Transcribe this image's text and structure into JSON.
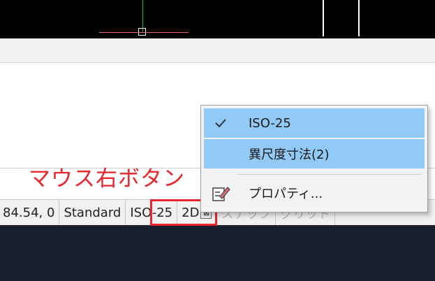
{
  "annotation": {
    "label": "マウス右ボタン"
  },
  "statusbar": {
    "coordinates": "84.54, 0",
    "text_style": "Standard",
    "dim_style": "ISO-25",
    "mode": "2D",
    "snap_label": "スナップ",
    "grid_label": "グリッド"
  },
  "context_menu": {
    "items": [
      {
        "label": "ISO-25",
        "checked": true,
        "icon": "checkmark-icon"
      },
      {
        "label": "異尺度寸法(2)",
        "highlighted": true
      },
      {
        "label": "プロパティ...",
        "icon": "properties-pencil-icon"
      }
    ]
  },
  "colors": {
    "annotation_red": "#e8262c",
    "menu_highlight": "#91c9f7",
    "viewport_bg": "#000000",
    "bottom_bg": "#17202c"
  }
}
